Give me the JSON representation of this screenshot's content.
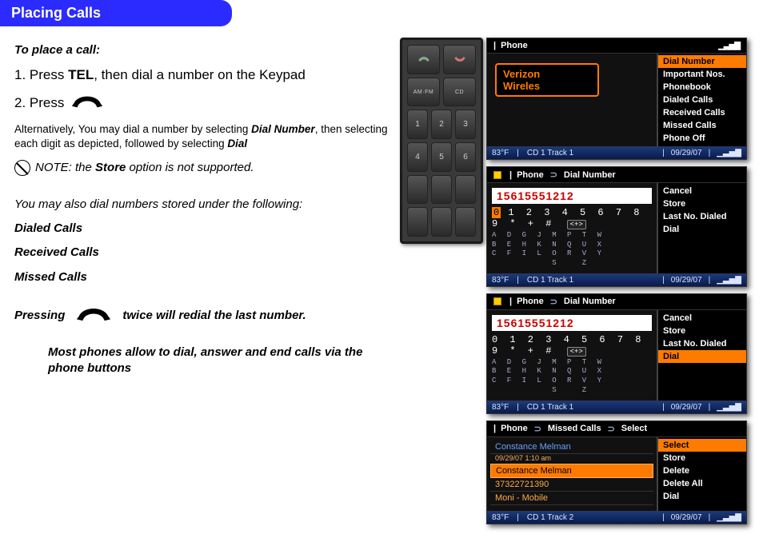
{
  "header": {
    "title": "Placing Calls"
  },
  "left": {
    "subhead": "To place a call:",
    "step1_pre": "1. Press ",
    "step1_bold": "TEL",
    "step1_post": ", then dial a number on the  Keypad",
    "step2": "2. Press",
    "alt_pre": "Alternatively, You may dial a number by selecting ",
    "alt_b1": "Dial Number",
    "alt_mid": ", then selecting each digit as depicted, followed by selecting ",
    "alt_b2": "Dial",
    "note_pre": "NOTE: ",
    "note_mid": "the ",
    "note_bold": "Store",
    "note_post": " option is not supported.",
    "may_also": "You may also dial numbers stored under the following:",
    "cat1": "Dialed Calls",
    "cat2": "Received Calls",
    "cat3": "Missed Calls",
    "redial_pre": "Pressing",
    "redial_post": "twice will redial the last number.",
    "most_phones": "Most phones allow to dial, answer and end calls via the phone buttons"
  },
  "keypad": {
    "amfm": "AM·FM",
    "cd": "CD",
    "k1": "1",
    "k2": "2",
    "k3": "3",
    "k4": "4",
    "k5": "5",
    "k6": "6"
  },
  "status": {
    "temp": "83°F",
    "track1": "CD 1 Track 1",
    "track2": "CD 1 Track 2",
    "date": "09/29/07",
    "sig": "▁▃▅▇"
  },
  "screen1": {
    "title": "Phone",
    "carrier_l1": "Verizon",
    "carrier_l2": "Wireles",
    "menu": [
      "Dial Number",
      "Important Nos.",
      "Phonebook",
      "Dialed Calls",
      "Received Calls",
      "Missed Calls",
      "Phone Off"
    ],
    "sel_index": 0
  },
  "screen2": {
    "title_pre": "Phone",
    "title_post": "Dial Number",
    "number": "15615551212",
    "digits": "0 1 2 3 4 5 6 7 8 9 * + #",
    "chip": "<+>",
    "alpha1": "A D G J M P T W",
    "alpha2": "B E H K N Q U X",
    "alpha3": "C F I L O R V Y",
    "alpha4": "        S   Z",
    "menu": [
      "Cancel",
      "Store",
      "Last No. Dialed",
      "Dial"
    ],
    "highlight_first_digit": true
  },
  "screen3": {
    "title_pre": "Phone",
    "title_post": "Dial Number",
    "number": "15615551212",
    "digits": "0 1 2 3 4 5 6 7 8 9 * + #",
    "chip": "<+>",
    "alpha1": "A D G J M P T W",
    "alpha2": "B E H K N Q U X",
    "alpha3": "C F I L O R V Y",
    "alpha4": "        S   Z",
    "menu": [
      "Cancel",
      "Store",
      "Last No. Dialed",
      "Dial"
    ],
    "sel_index": 3
  },
  "screen4": {
    "title_pre": "Phone",
    "title_mid": "Missed Calls",
    "title_post": "Select",
    "rows": [
      {
        "name": "Constance Melman",
        "sub": "09/29/07 1:10 am",
        "blue": true
      },
      {
        "name": "Constance Melman",
        "sel": true
      },
      {
        "name": "37322721390"
      },
      {
        "name": "Moni - Mobile"
      }
    ],
    "menu": [
      "Select",
      "Store",
      "Delete",
      "Delete All",
      "Dial"
    ],
    "sel_index": 0
  }
}
